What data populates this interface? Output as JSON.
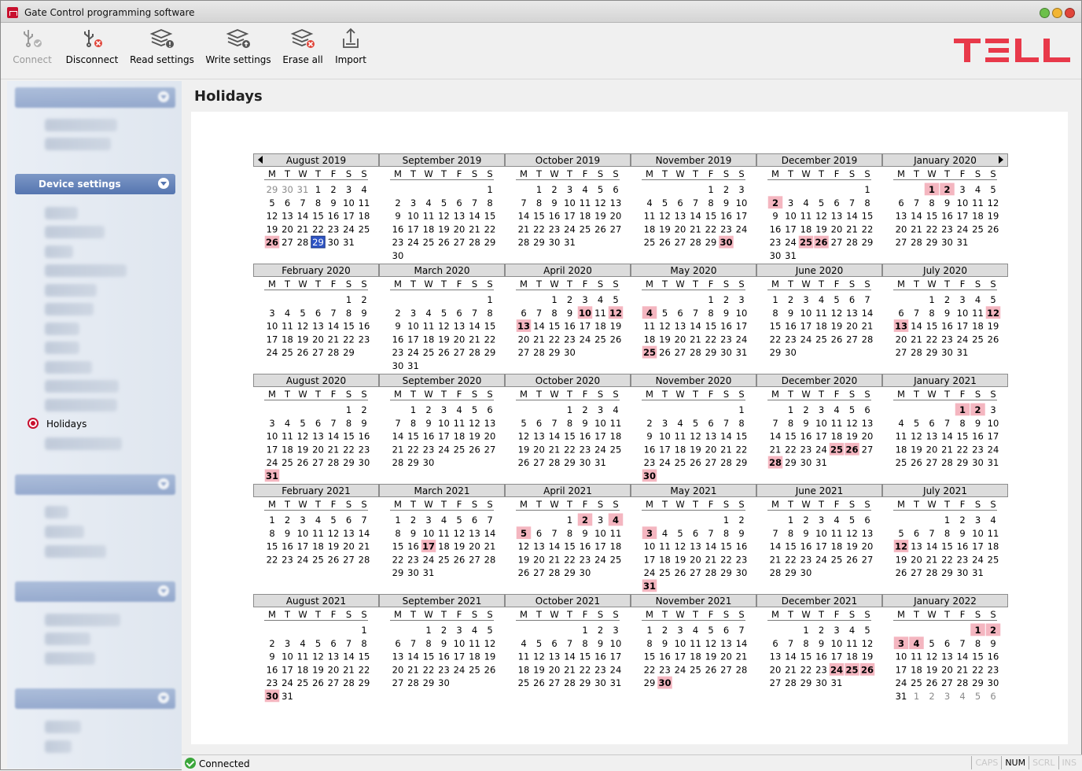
{
  "window": {
    "title": "Gate Control programming software",
    "buttons": [
      {
        "name": "minimize-button",
        "color": "#6cc04a"
      },
      {
        "name": "maximize-button",
        "color": "#f2b532"
      },
      {
        "name": "close-button",
        "color": "#e0453a"
      }
    ]
  },
  "toolbar": {
    "buttons": [
      {
        "id": "connect",
        "label": "Connect",
        "icon": "usb-connect-icon",
        "enabled": false
      },
      {
        "id": "disconnect",
        "label": "Disconnect",
        "icon": "usb-disconnect-icon",
        "enabled": true
      },
      {
        "id": "read",
        "label": "Read settings",
        "icon": "read-settings-icon",
        "enabled": true
      },
      {
        "id": "write",
        "label": "Write settings",
        "icon": "write-settings-icon",
        "enabled": true
      },
      {
        "id": "erase",
        "label": "Erase all",
        "icon": "erase-all-icon",
        "enabled": true
      },
      {
        "id": "import",
        "label": "Import",
        "icon": "import-icon",
        "enabled": true
      }
    ],
    "logo_text": "TELL",
    "logo_color": "#e8394a"
  },
  "sidebar": {
    "device_settings_header": "Device settings",
    "active_item": "Holidays"
  },
  "page": {
    "title": "Holidays"
  },
  "calendar": {
    "weekday_headers": [
      "M",
      "T",
      "W",
      "T",
      "F",
      "S",
      "S"
    ],
    "highlight_color": "#f4b6c0",
    "today_color": "#2e54c5",
    "months": [
      {
        "title": "August 2019",
        "year": 2019,
        "month": 8,
        "holidays": [
          26
        ],
        "today": 29
      },
      {
        "title": "September 2019",
        "year": 2019,
        "month": 9,
        "holidays": []
      },
      {
        "title": "October 2019",
        "year": 2019,
        "month": 10,
        "holidays": []
      },
      {
        "title": "November 2019",
        "year": 2019,
        "month": 11,
        "holidays": [
          30
        ]
      },
      {
        "title": "December 2019",
        "year": 2019,
        "month": 12,
        "holidays": [
          2,
          25,
          26
        ]
      },
      {
        "title": "January 2020",
        "year": 2020,
        "month": 1,
        "holidays": [
          1,
          2
        ]
      },
      {
        "title": "February 2020",
        "year": 2020,
        "month": 2,
        "holidays": []
      },
      {
        "title": "March 2020",
        "year": 2020,
        "month": 3,
        "holidays": []
      },
      {
        "title": "April 2020",
        "year": 2020,
        "month": 4,
        "holidays": [
          10,
          12,
          13
        ]
      },
      {
        "title": "May 2020",
        "year": 2020,
        "month": 5,
        "holidays": [
          4,
          25
        ]
      },
      {
        "title": "June 2020",
        "year": 2020,
        "month": 6,
        "holidays": []
      },
      {
        "title": "July 2020",
        "year": 2020,
        "month": 7,
        "holidays": [
          12,
          13
        ]
      },
      {
        "title": "August 2020",
        "year": 2020,
        "month": 8,
        "holidays": [
          31
        ]
      },
      {
        "title": "September 2020",
        "year": 2020,
        "month": 9,
        "holidays": []
      },
      {
        "title": "October 2020",
        "year": 2020,
        "month": 10,
        "holidays": []
      },
      {
        "title": "November 2020",
        "year": 2020,
        "month": 11,
        "holidays": [
          30
        ]
      },
      {
        "title": "December 2020",
        "year": 2020,
        "month": 12,
        "holidays": [
          25,
          26,
          28
        ]
      },
      {
        "title": "January 2021",
        "year": 2021,
        "month": 1,
        "holidays": [
          1,
          2
        ]
      },
      {
        "title": "February 2021",
        "year": 2021,
        "month": 2,
        "holidays": []
      },
      {
        "title": "March 2021",
        "year": 2021,
        "month": 3,
        "holidays": [
          17
        ]
      },
      {
        "title": "April 2021",
        "year": 2021,
        "month": 4,
        "holidays": [
          2,
          4,
          5
        ]
      },
      {
        "title": "May 2021",
        "year": 2021,
        "month": 5,
        "holidays": [
          3,
          31
        ]
      },
      {
        "title": "June 2021",
        "year": 2021,
        "month": 6,
        "holidays": []
      },
      {
        "title": "July 2021",
        "year": 2021,
        "month": 7,
        "holidays": [
          12
        ]
      },
      {
        "title": "August 2021",
        "year": 2021,
        "month": 8,
        "holidays": [
          30
        ]
      },
      {
        "title": "September 2021",
        "year": 2021,
        "month": 9,
        "holidays": []
      },
      {
        "title": "October 2021",
        "year": 2021,
        "month": 10,
        "holidays": []
      },
      {
        "title": "November 2021",
        "year": 2021,
        "month": 11,
        "holidays": [
          30
        ]
      },
      {
        "title": "December 2021",
        "year": 2021,
        "month": 12,
        "holidays": [
          24,
          25,
          26
        ]
      },
      {
        "title": "January 2022",
        "year": 2022,
        "month": 1,
        "holidays": [
          1,
          2,
          3,
          4
        ]
      }
    ]
  },
  "statusbar": {
    "status_text": "Connected",
    "keys": [
      {
        "label": "CAPS",
        "active": false
      },
      {
        "label": "NUM",
        "active": true
      },
      {
        "label": "SCRL",
        "active": false
      },
      {
        "label": "INS",
        "active": false
      }
    ]
  }
}
